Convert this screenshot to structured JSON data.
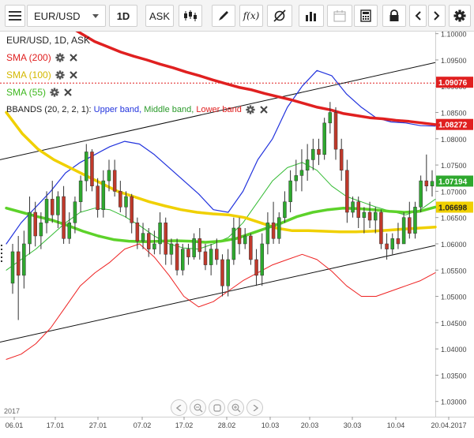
{
  "toolbar": {
    "symbol": "EUR/USD",
    "timeframe": "1D",
    "price_side": "ASK",
    "fx_label": "f(x)"
  },
  "chart_info": {
    "title": "EUR/USD, 1D, ASK",
    "year_label": "2017"
  },
  "legend": {
    "sma200": "SMA (200)",
    "sma100": "SMA (100)",
    "sma55": "SMA (55)",
    "bbands_prefix": "BBANDS (20, 2, 2, 1):",
    "bbands_upper": "Upper band,",
    "bbands_middle": "Middle band,",
    "bbands_lower": "Lower band"
  },
  "colors": {
    "up": "#2ea82e",
    "down": "#c0392b",
    "sma200": "#e02020",
    "sma100": "#f0d000",
    "sma55": "#5dd22a",
    "upper": "#2233dd",
    "middle": "#33bb33",
    "lower": "#ee2222",
    "channel": "#111111",
    "price_marker": "#e02020",
    "value_tag_green": "#2ea82e",
    "value_tag_yellow": "#f0d000",
    "value_tag_red": "#e02020"
  },
  "chart_data": {
    "type": "candlestick",
    "symbol": "EUR/USD",
    "ylim": [
      1.027,
      1.102
    ],
    "y_ticks": [
      "1.10000",
      "1.09500",
      "1.09000",
      "1.08500",
      "1.08000",
      "1.07500",
      "1.07000",
      "1.06500",
      "1.06000",
      "1.05500",
      "1.05000",
      "1.04500",
      "1.04000",
      "1.03500",
      "1.03000"
    ],
    "x_ticks": [
      "06.01",
      "17.01",
      "27.01",
      "07.02",
      "17.02",
      "28.02",
      "10.03",
      "20.03",
      "30.03",
      "10.04",
      "20.04.2017"
    ],
    "value_tags": {
      "current": "1.09076",
      "sma200": "1.08272",
      "close": "1.07194",
      "sma55": "1.06698"
    },
    "current_price_line": 1.0906,
    "candles": [
      {
        "o": 1.0525,
        "h": 1.06,
        "l": 1.0505,
        "c": 1.0585
      },
      {
        "o": 1.0585,
        "h": 1.0615,
        "l": 1.0455,
        "c": 1.054
      },
      {
        "o": 1.054,
        "h": 1.0625,
        "l": 1.0515,
        "c": 1.06
      },
      {
        "o": 1.06,
        "h": 1.069,
        "l": 1.058,
        "c": 1.066
      },
      {
        "o": 1.066,
        "h": 1.068,
        "l": 1.0595,
        "c": 1.0615
      },
      {
        "o": 1.0615,
        "h": 1.066,
        "l": 1.059,
        "c": 1.064
      },
      {
        "o": 1.064,
        "h": 1.07,
        "l": 1.062,
        "c": 1.0685
      },
      {
        "o": 1.0685,
        "h": 1.072,
        "l": 1.064,
        "c": 1.0655
      },
      {
        "o": 1.0655,
        "h": 1.07,
        "l": 1.063,
        "c": 1.069
      },
      {
        "o": 1.069,
        "h": 1.071,
        "l": 1.06,
        "c": 1.061
      },
      {
        "o": 1.061,
        "h": 1.066,
        "l": 1.06,
        "c": 1.064
      },
      {
        "o": 1.064,
        "h": 1.069,
        "l": 1.062,
        "c": 1.068
      },
      {
        "o": 1.068,
        "h": 1.073,
        "l": 1.066,
        "c": 1.072
      },
      {
        "o": 1.072,
        "h": 1.079,
        "l": 1.07,
        "c": 1.0775
      },
      {
        "o": 1.0775,
        "h": 1.078,
        "l": 1.07,
        "c": 1.071
      },
      {
        "o": 1.071,
        "h": 1.0725,
        "l": 1.065,
        "c": 1.0665
      },
      {
        "o": 1.0665,
        "h": 1.074,
        "l": 1.065,
        "c": 1.072
      },
      {
        "o": 1.072,
        "h": 1.076,
        "l": 1.07,
        "c": 1.074
      },
      {
        "o": 1.074,
        "h": 1.076,
        "l": 1.069,
        "c": 1.07
      },
      {
        "o": 1.07,
        "h": 1.072,
        "l": 1.066,
        "c": 1.067
      },
      {
        "o": 1.067,
        "h": 1.07,
        "l": 1.065,
        "c": 1.069
      },
      {
        "o": 1.069,
        "h": 1.0695,
        "l": 1.062,
        "c": 1.064
      },
      {
        "o": 1.064,
        "h": 1.065,
        "l": 1.059,
        "c": 1.0605
      },
      {
        "o": 1.0605,
        "h": 1.064,
        "l": 1.059,
        "c": 1.062
      },
      {
        "o": 1.062,
        "h": 1.063,
        "l": 1.0575,
        "c": 1.059
      },
      {
        "o": 1.059,
        "h": 1.0625,
        "l": 1.058,
        "c": 1.06
      },
      {
        "o": 1.06,
        "h": 1.066,
        "l": 1.058,
        "c": 1.064
      },
      {
        "o": 1.064,
        "h": 1.065,
        "l": 1.056,
        "c": 1.058
      },
      {
        "o": 1.058,
        "h": 1.061,
        "l": 1.056,
        "c": 1.06
      },
      {
        "o": 1.06,
        "h": 1.061,
        "l": 1.054,
        "c": 1.055
      },
      {
        "o": 1.055,
        "h": 1.06,
        "l": 1.054,
        "c": 1.059
      },
      {
        "o": 1.059,
        "h": 1.06,
        "l": 1.056,
        "c": 1.0575
      },
      {
        "o": 1.0575,
        "h": 1.062,
        "l": 1.057,
        "c": 1.061
      },
      {
        "o": 1.061,
        "h": 1.063,
        "l": 1.057,
        "c": 1.0585
      },
      {
        "o": 1.0585,
        "h": 1.06,
        "l": 1.055,
        "c": 1.056
      },
      {
        "o": 1.056,
        "h": 1.06,
        "l": 1.054,
        "c": 1.059
      },
      {
        "o": 1.059,
        "h": 1.061,
        "l": 1.056,
        "c": 1.057
      },
      {
        "o": 1.057,
        "h": 1.058,
        "l": 1.05,
        "c": 1.052
      },
      {
        "o": 1.052,
        "h": 1.059,
        "l": 1.05,
        "c": 1.057
      },
      {
        "o": 1.057,
        "h": 1.065,
        "l": 1.056,
        "c": 1.063
      },
      {
        "o": 1.063,
        "h": 1.065,
        "l": 1.058,
        "c": 1.06
      },
      {
        "o": 1.06,
        "h": 1.063,
        "l": 1.059,
        "c": 1.0615
      },
      {
        "o": 1.0615,
        "h": 1.062,
        "l": 1.056,
        "c": 1.057
      },
      {
        "o": 1.057,
        "h": 1.059,
        "l": 1.052,
        "c": 1.054
      },
      {
        "o": 1.054,
        "h": 1.062,
        "l": 1.052,
        "c": 1.06
      },
      {
        "o": 1.06,
        "h": 1.066,
        "l": 1.058,
        "c": 1.064
      },
      {
        "o": 1.064,
        "h": 1.068,
        "l": 1.06,
        "c": 1.061
      },
      {
        "o": 1.061,
        "h": 1.066,
        "l": 1.06,
        "c": 1.065
      },
      {
        "o": 1.065,
        "h": 1.07,
        "l": 1.064,
        "c": 1.068
      },
      {
        "o": 1.068,
        "h": 1.074,
        "l": 1.066,
        "c": 1.072
      },
      {
        "o": 1.072,
        "h": 1.076,
        "l": 1.07,
        "c": 1.073
      },
      {
        "o": 1.073,
        "h": 1.078,
        "l": 1.07,
        "c": 1.074
      },
      {
        "o": 1.074,
        "h": 1.079,
        "l": 1.072,
        "c": 1.076
      },
      {
        "o": 1.076,
        "h": 1.08,
        "l": 1.074,
        "c": 1.078
      },
      {
        "o": 1.078,
        "h": 1.08,
        "l": 1.075,
        "c": 1.077
      },
      {
        "o": 1.077,
        "h": 1.084,
        "l": 1.076,
        "c": 1.083
      },
      {
        "o": 1.083,
        "h": 1.087,
        "l": 1.081,
        "c": 1.085
      },
      {
        "o": 1.085,
        "h": 1.086,
        "l": 1.076,
        "c": 1.078
      },
      {
        "o": 1.078,
        "h": 1.08,
        "l": 1.072,
        "c": 1.074
      },
      {
        "o": 1.074,
        "h": 1.076,
        "l": 1.064,
        "c": 1.066
      },
      {
        "o": 1.066,
        "h": 1.069,
        "l": 1.065,
        "c": 1.068
      },
      {
        "o": 1.068,
        "h": 1.069,
        "l": 1.063,
        "c": 1.065
      },
      {
        "o": 1.065,
        "h": 1.067,
        "l": 1.062,
        "c": 1.066
      },
      {
        "o": 1.066,
        "h": 1.068,
        "l": 1.063,
        "c": 1.0645
      },
      {
        "o": 1.0645,
        "h": 1.067,
        "l": 1.062,
        "c": 1.066
      },
      {
        "o": 1.066,
        "h": 1.0665,
        "l": 1.059,
        "c": 1.06
      },
      {
        "o": 1.06,
        "h": 1.062,
        "l": 1.057,
        "c": 1.059
      },
      {
        "o": 1.059,
        "h": 1.062,
        "l": 1.058,
        "c": 1.061
      },
      {
        "o": 1.061,
        "h": 1.064,
        "l": 1.059,
        "c": 1.06
      },
      {
        "o": 1.06,
        "h": 1.066,
        "l": 1.06,
        "c": 1.065
      },
      {
        "o": 1.065,
        "h": 1.068,
        "l": 1.061,
        "c": 1.062
      },
      {
        "o": 1.062,
        "h": 1.068,
        "l": 1.061,
        "c": 1.067
      },
      {
        "o": 1.067,
        "h": 1.073,
        "l": 1.066,
        "c": 1.072
      },
      {
        "o": 1.072,
        "h": 1.077,
        "l": 1.07,
        "c": 1.071
      },
      {
        "o": 1.071,
        "h": 1.074,
        "l": 1.069,
        "c": 1.0719
      }
    ],
    "series": [
      {
        "name": "SMA (200)",
        "values": [
          1.103,
          1.1015,
          1.1,
          1.0985,
          1.0975,
          1.0965,
          1.0957,
          1.095,
          1.0942,
          1.0935,
          1.0927,
          1.092,
          1.0912,
          1.0905,
          1.0898,
          1.0893,
          1.0886,
          1.088,
          1.0874,
          1.0867,
          1.086,
          1.0855,
          1.0848,
          1.0844,
          1.084,
          1.0838,
          1.0835,
          1.0833,
          1.083,
          1.0827
        ]
      },
      {
        "name": "SMA (100)",
        "values": [
          1.085,
          1.081,
          1.078,
          1.076,
          1.0745,
          1.073,
          1.0715,
          1.07,
          1.069,
          1.068,
          1.0672,
          1.0665,
          1.066,
          1.0657,
          1.0655,
          1.065,
          1.064,
          1.063,
          1.0625,
          1.0625,
          1.0624,
          1.0623,
          1.0623,
          1.0624,
          1.0626,
          1.0628,
          1.063,
          1.0632
        ]
      },
      {
        "name": "SMA (55)",
        "values": [
          1.0668,
          1.066,
          1.0652,
          1.0645,
          1.0635,
          1.0624,
          1.0615,
          1.0608,
          1.0605,
          1.0604,
          1.0605,
          1.0606,
          1.0605,
          1.0603,
          1.0605,
          1.061,
          1.062,
          1.063,
          1.064,
          1.0652,
          1.066,
          1.0665,
          1.0668,
          1.0667,
          1.0665,
          1.0662,
          1.066,
          1.0662,
          1.067
        ]
      },
      {
        "name": "Upper band",
        "values": [
          1.06,
          1.064,
          1.067,
          1.07,
          1.0735,
          1.0755,
          1.077,
          1.0785,
          1.0795,
          1.079,
          1.077,
          1.0745,
          1.072,
          1.0695,
          1.0665,
          1.066,
          1.07,
          1.076,
          1.08,
          1.086,
          1.09,
          1.093,
          1.092,
          1.0885,
          1.086,
          1.084,
          1.0832,
          1.083,
          1.0825,
          1.0824
        ]
      },
      {
        "name": "Middle band",
        "values": [
          1.055,
          1.057,
          1.059,
          1.0615,
          1.064,
          1.066,
          1.0668,
          1.0665,
          1.0652,
          1.0635,
          1.0615,
          1.06,
          1.0592,
          1.059,
          1.06,
          1.0612,
          1.064,
          1.068,
          1.072,
          1.0745,
          1.0755,
          1.074,
          1.071,
          1.069,
          1.068,
          1.067,
          1.0662,
          1.0655,
          1.0665,
          1.0685
        ]
      },
      {
        "name": "Lower band",
        "values": [
          1.038,
          1.039,
          1.041,
          1.044,
          1.048,
          1.052,
          1.0545,
          1.0565,
          1.059,
          1.06,
          1.0575,
          1.054,
          1.05,
          1.048,
          1.049,
          1.051,
          1.053,
          1.0545,
          1.056,
          1.057,
          1.058,
          1.057,
          1.0548,
          1.052,
          1.05,
          1.05,
          1.051,
          1.052,
          1.053,
          1.0545
        ]
      }
    ],
    "channel_lines": [
      {
        "name": "upper channel",
        "start": 1.076,
        "end": 1.0945
      },
      {
        "name": "lower channel",
        "start": 1.0413,
        "end": 1.0597
      }
    ]
  }
}
